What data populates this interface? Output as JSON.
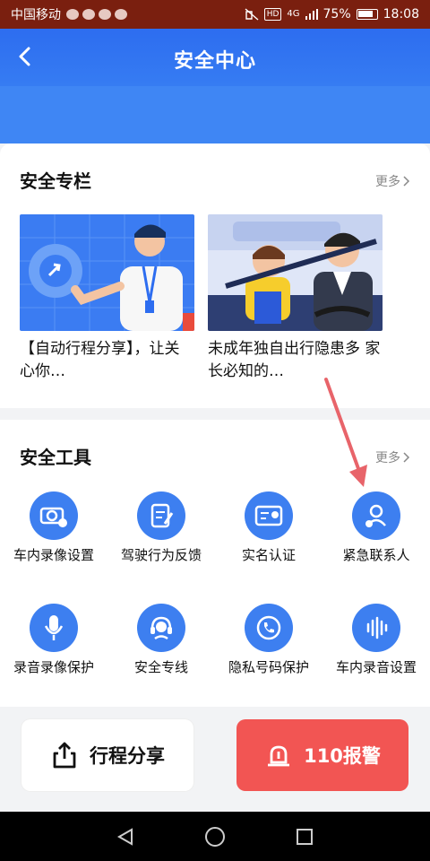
{
  "status_bar": {
    "carrier": "中国移动",
    "hd": "HD",
    "network": "4G",
    "battery": "75%",
    "time": "18:08"
  },
  "header": {
    "title": "安全中心"
  },
  "column": {
    "title": "安全专栏",
    "more": "更多",
    "articles": [
      {
        "text": "【自动行程分享】，让关心你…"
      },
      {
        "text": "未成年独自出行隐患多 家长必知的…"
      }
    ]
  },
  "tools": {
    "title": "安全工具",
    "more": "更多",
    "items": [
      {
        "label": "车内录像设置",
        "icon": "camera-settings-icon"
      },
      {
        "label": "驾驶行为反馈",
        "icon": "driving-feedback-icon"
      },
      {
        "label": "实名认证",
        "icon": "id-card-icon"
      },
      {
        "label": "紧急联系人",
        "icon": "emergency-contact-icon"
      },
      {
        "label": "录音录像保护",
        "icon": "microphone-icon"
      },
      {
        "label": "安全专线",
        "icon": "headset-icon"
      },
      {
        "label": "隐私号码保护",
        "icon": "phone-privacy-icon"
      },
      {
        "label": "车内录音设置",
        "icon": "audio-wave-icon"
      }
    ]
  },
  "actions": {
    "share": "行程分享",
    "sos": "110报警"
  },
  "colors": {
    "primary": "#3d7ff0",
    "danger": "#f25553",
    "annotation": "#e8646a"
  }
}
